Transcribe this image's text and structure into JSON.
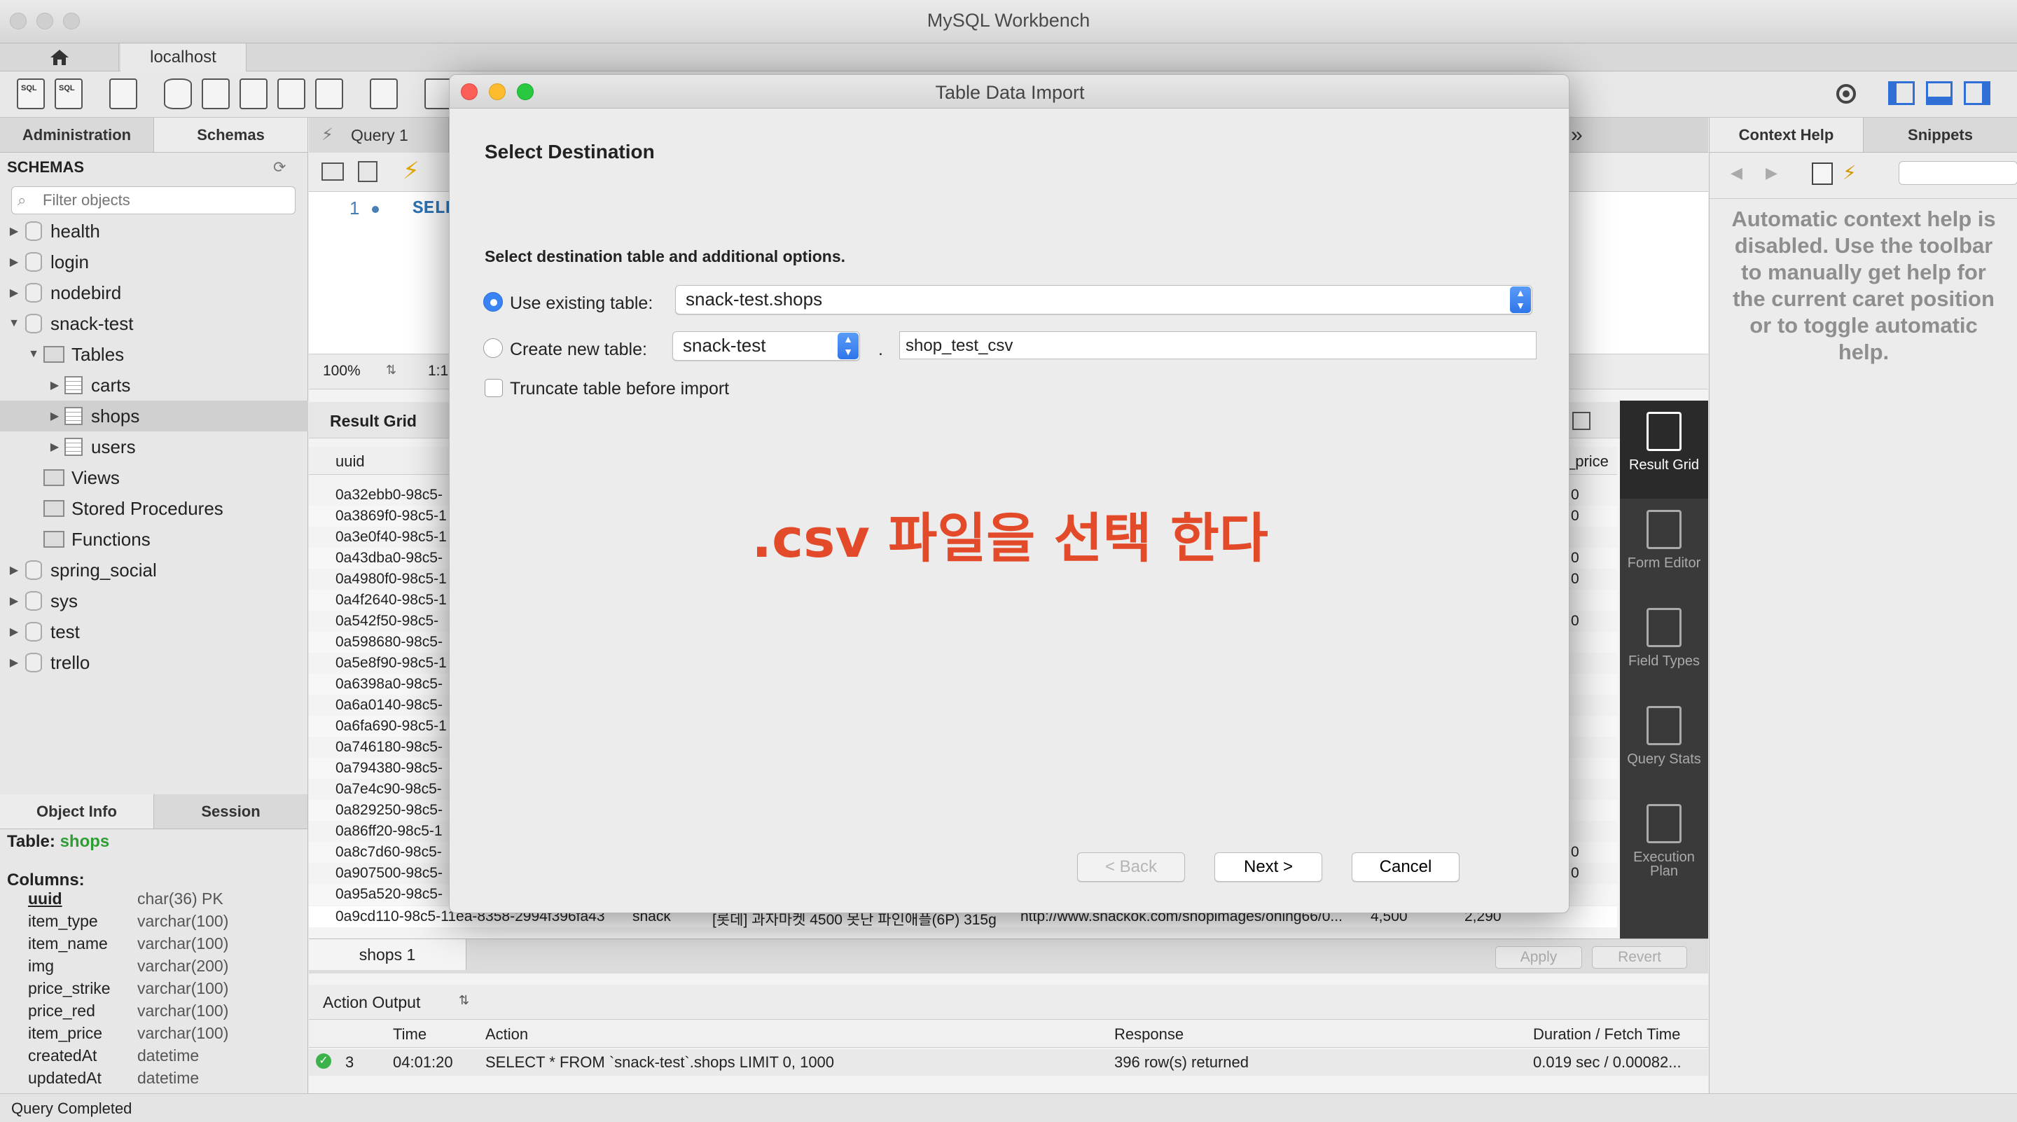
{
  "app": {
    "window_title": "MySQL Workbench",
    "connection_tab": "localhost"
  },
  "sidebar": {
    "tabs": [
      "Administration",
      "Schemas"
    ],
    "section_title": "SCHEMAS",
    "filter_placeholder": "Filter objects",
    "tree": [
      {
        "label": "health",
        "kind": "db",
        "expanded": false
      },
      {
        "label": "login",
        "kind": "db",
        "expanded": false
      },
      {
        "label": "nodebird",
        "kind": "db",
        "expanded": false
      },
      {
        "label": "snack-test",
        "kind": "db",
        "expanded": true
      },
      {
        "label": "Tables",
        "kind": "folder",
        "expanded": true
      },
      {
        "label": "carts",
        "kind": "table",
        "expanded": false
      },
      {
        "label": "shops",
        "kind": "table",
        "expanded": false,
        "selected": true
      },
      {
        "label": "users",
        "kind": "table",
        "expanded": false
      },
      {
        "label": "Views",
        "kind": "folder"
      },
      {
        "label": "Stored Procedures",
        "kind": "folder"
      },
      {
        "label": "Functions",
        "kind": "folder"
      },
      {
        "label": "spring_social",
        "kind": "db",
        "expanded": false
      },
      {
        "label": "sys",
        "kind": "db",
        "expanded": false
      },
      {
        "label": "test",
        "kind": "db",
        "expanded": false
      },
      {
        "label": "trello",
        "kind": "db",
        "expanded": false
      }
    ],
    "info_tabs": [
      "Object Info",
      "Session"
    ],
    "info_table_label": "Table:",
    "info_table_name": "shops",
    "columns_title": "Columns:",
    "columns": [
      {
        "name": "uuid",
        "type": "char(36) PK"
      },
      {
        "name": "item_type",
        "type": "varchar(100)"
      },
      {
        "name": "item_name",
        "type": "varchar(100)"
      },
      {
        "name": "img",
        "type": "varchar(200)"
      },
      {
        "name": "price_strike",
        "type": "varchar(100)"
      },
      {
        "name": "price_red",
        "type": "varchar(100)"
      },
      {
        "name": "item_price",
        "type": "varchar(100)"
      },
      {
        "name": "createdAt",
        "type": "datetime"
      },
      {
        "name": "updatedAt",
        "type": "datetime"
      }
    ]
  },
  "editor": {
    "query_tab": "Query 1",
    "line_number": "1",
    "code": "SELE",
    "zoom": "100%",
    "zoom_ratio": "1:1"
  },
  "result_grid": {
    "tab": "Result Grid",
    "col_uuid": "uuid",
    "col_price": "_price",
    "rows": [
      {
        "uuid": "0a32ebb0-98c5-",
        "price": "0"
      },
      {
        "uuid": "0a3869f0-98c5-1",
        "price": "0"
      },
      {
        "uuid": "0a3e0f40-98c5-1",
        "price": ""
      },
      {
        "uuid": "0a43dba0-98c5-",
        "price": "0"
      },
      {
        "uuid": "0a4980f0-98c5-1",
        "price": "0"
      },
      {
        "uuid": "0a4f2640-98c5-1",
        "price": ""
      },
      {
        "uuid": "0a542f50-98c5-",
        "price": "0"
      },
      {
        "uuid": "0a598680-98c5-",
        "price": ""
      },
      {
        "uuid": "0a5e8f90-98c5-1",
        "price": ""
      },
      {
        "uuid": "0a6398a0-98c5-",
        "price": ""
      },
      {
        "uuid": "0a6a0140-98c5-",
        "price": ""
      },
      {
        "uuid": "0a6fa690-98c5-1",
        "price": ""
      },
      {
        "uuid": "0a746180-98c5-",
        "price": ""
      },
      {
        "uuid": "0a794380-98c5-",
        "price": ""
      },
      {
        "uuid": "0a7e4c90-98c5-",
        "price": ""
      },
      {
        "uuid": "0a829250-98c5-",
        "price": ""
      },
      {
        "uuid": "0a86ff20-98c5-1",
        "price": ""
      },
      {
        "uuid": "0a8c7d60-98c5-",
        "price": "0"
      },
      {
        "uuid": "0a907500-98c5-",
        "price": "0"
      },
      {
        "uuid": "0a95a520-98c5-",
        "price": ""
      }
    ],
    "tail_row": {
      "uuid": "0a9cd110-98c5-11ea-8358-2994f396fa43",
      "type": "snack",
      "name": "[롯데] 과자마켓 4500 못난 파인애플(6P) 315g",
      "img": "http://www.snackok.com/shopimages/ohing66/0...",
      "strike": "4,500",
      "price": "2,290"
    },
    "view_switch": [
      {
        "label": "Result Grid",
        "active": true
      },
      {
        "label": "Form Editor",
        "active": false
      },
      {
        "label": "Field Types",
        "active": false
      },
      {
        "label": "Query Stats",
        "active": false
      },
      {
        "label": "Execution Plan",
        "active": false
      }
    ],
    "result_tab": "shops 1",
    "apply_label": "Apply",
    "revert_label": "Revert"
  },
  "output": {
    "title": "Action Output",
    "columns": [
      "Time",
      "Action",
      "Response",
      "Duration / Fetch Time"
    ],
    "row": {
      "num": "3",
      "time": "04:01:20",
      "action": "SELECT * FROM `snack-test`.shops LIMIT 0, 1000",
      "response": "396 row(s) returned",
      "duration": "0.019 sec / 0.00082..."
    }
  },
  "right_panel": {
    "tabs": [
      "Context Help",
      "Snippets"
    ],
    "help_text": "Automatic context help is disabled. Use the toolbar to manually get help for the current caret position or to toggle automatic help."
  },
  "status": "Query Completed",
  "dialog": {
    "title": "Table Data Import",
    "heading": "Select Destination",
    "subheading": "Select destination table and additional options.",
    "use_existing_label": "Use existing table:",
    "existing_table_value": "snack-test.shops",
    "create_new_label": "Create new table:",
    "new_schema_value": "snack-test",
    "dot": ".",
    "new_table_value": "shop_test_csv",
    "truncate_label": "Truncate table before import",
    "annotation": ".csv 파일을 선택 한다",
    "back_label": "< Back",
    "next_label": "Next >",
    "cancel_label": "Cancel",
    "annotation_color": "#e34a2a",
    "accent_color": "#3a83f5"
  }
}
